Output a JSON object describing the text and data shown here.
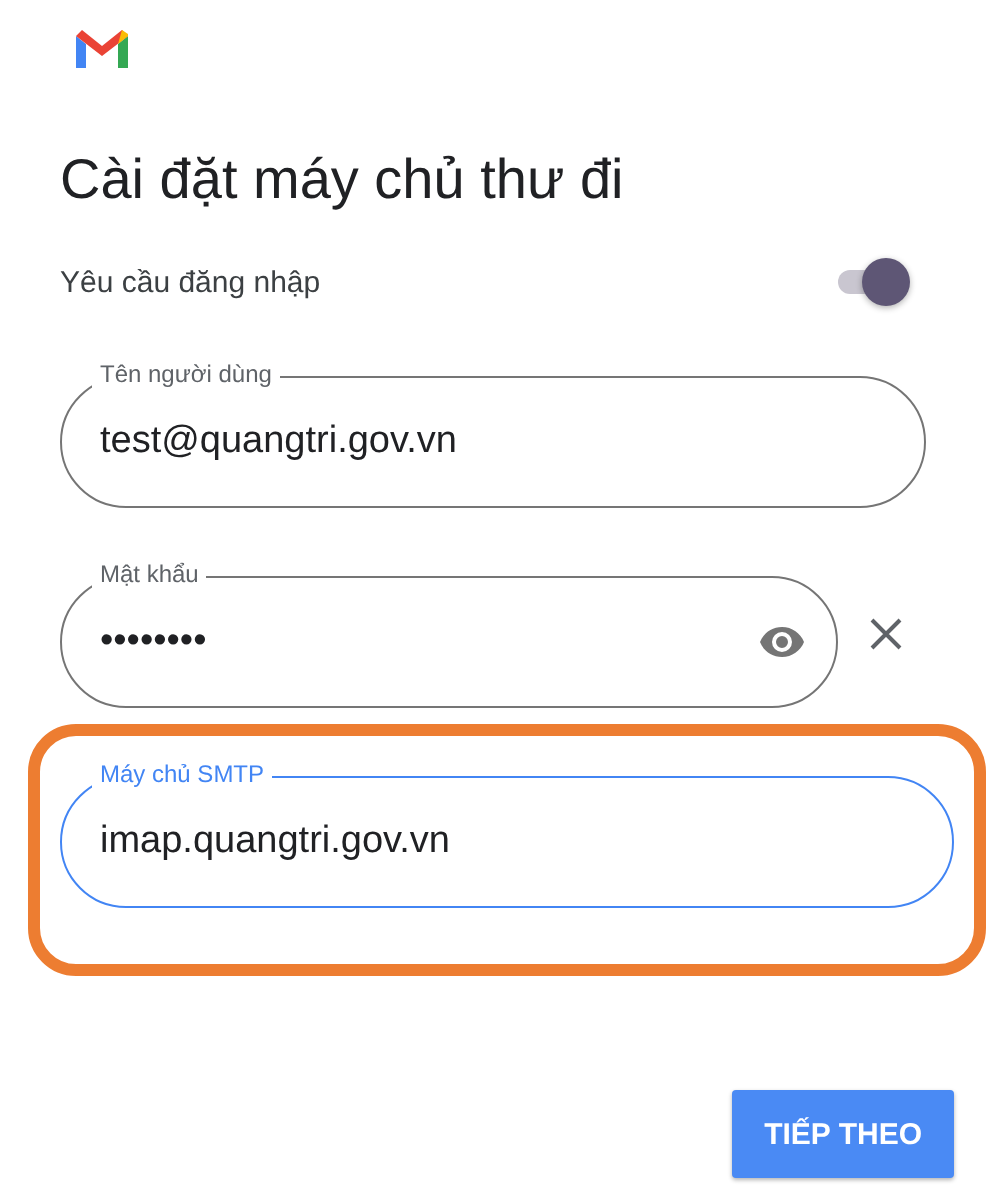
{
  "title": "Cài đặt máy chủ thư đi",
  "login_required": {
    "label": "Yêu cầu đăng nhập",
    "on": true
  },
  "fields": [
    {
      "label": "Tên người dùng",
      "value": "test@quangtri.gov.vn",
      "focused": false,
      "highlighted": false,
      "reveal_icon": false,
      "clear_icon": false
    },
    {
      "label": "Mật khẩu",
      "value": "••••••••",
      "focused": false,
      "highlighted": false,
      "reveal_icon": true,
      "clear_icon": true
    },
    {
      "label": "Máy chủ SMTP",
      "value": "imap.quangtri.gov.vn",
      "focused": true,
      "highlighted": true,
      "reveal_icon": false,
      "clear_icon": false
    }
  ],
  "next_button": "TIẾP THEO"
}
